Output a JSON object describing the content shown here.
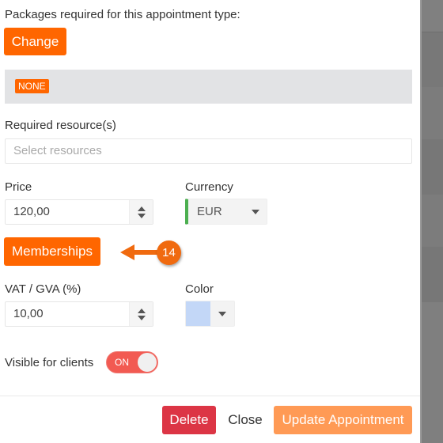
{
  "packages": {
    "label": "Packages required for this appointment type:",
    "change_button": "Change",
    "selected_badge": "NONE"
  },
  "resources": {
    "label": "Required resource(s)",
    "placeholder": "Select resources",
    "value": ""
  },
  "price": {
    "label": "Price",
    "value": "120,00"
  },
  "currency": {
    "label": "Currency",
    "selected": "EUR"
  },
  "memberships_button": "Memberships",
  "annotation": {
    "step_number": "14",
    "icon": "arrow-left-icon"
  },
  "vat": {
    "label": "VAT / GVA (%)",
    "value": "10,00"
  },
  "color": {
    "label": "Color",
    "value": "#c3d7f7"
  },
  "visible_for_clients": {
    "label": "Visible for clients",
    "state": "ON"
  },
  "footer": {
    "delete_label": "Delete",
    "close_label": "Close",
    "update_label": "Update Appointment"
  },
  "colors": {
    "accent": "#ff6600",
    "danger": "#dc3545",
    "primary_light": "#ff9a55",
    "success": "#4caf50",
    "toggle_on": "#f25a52"
  }
}
